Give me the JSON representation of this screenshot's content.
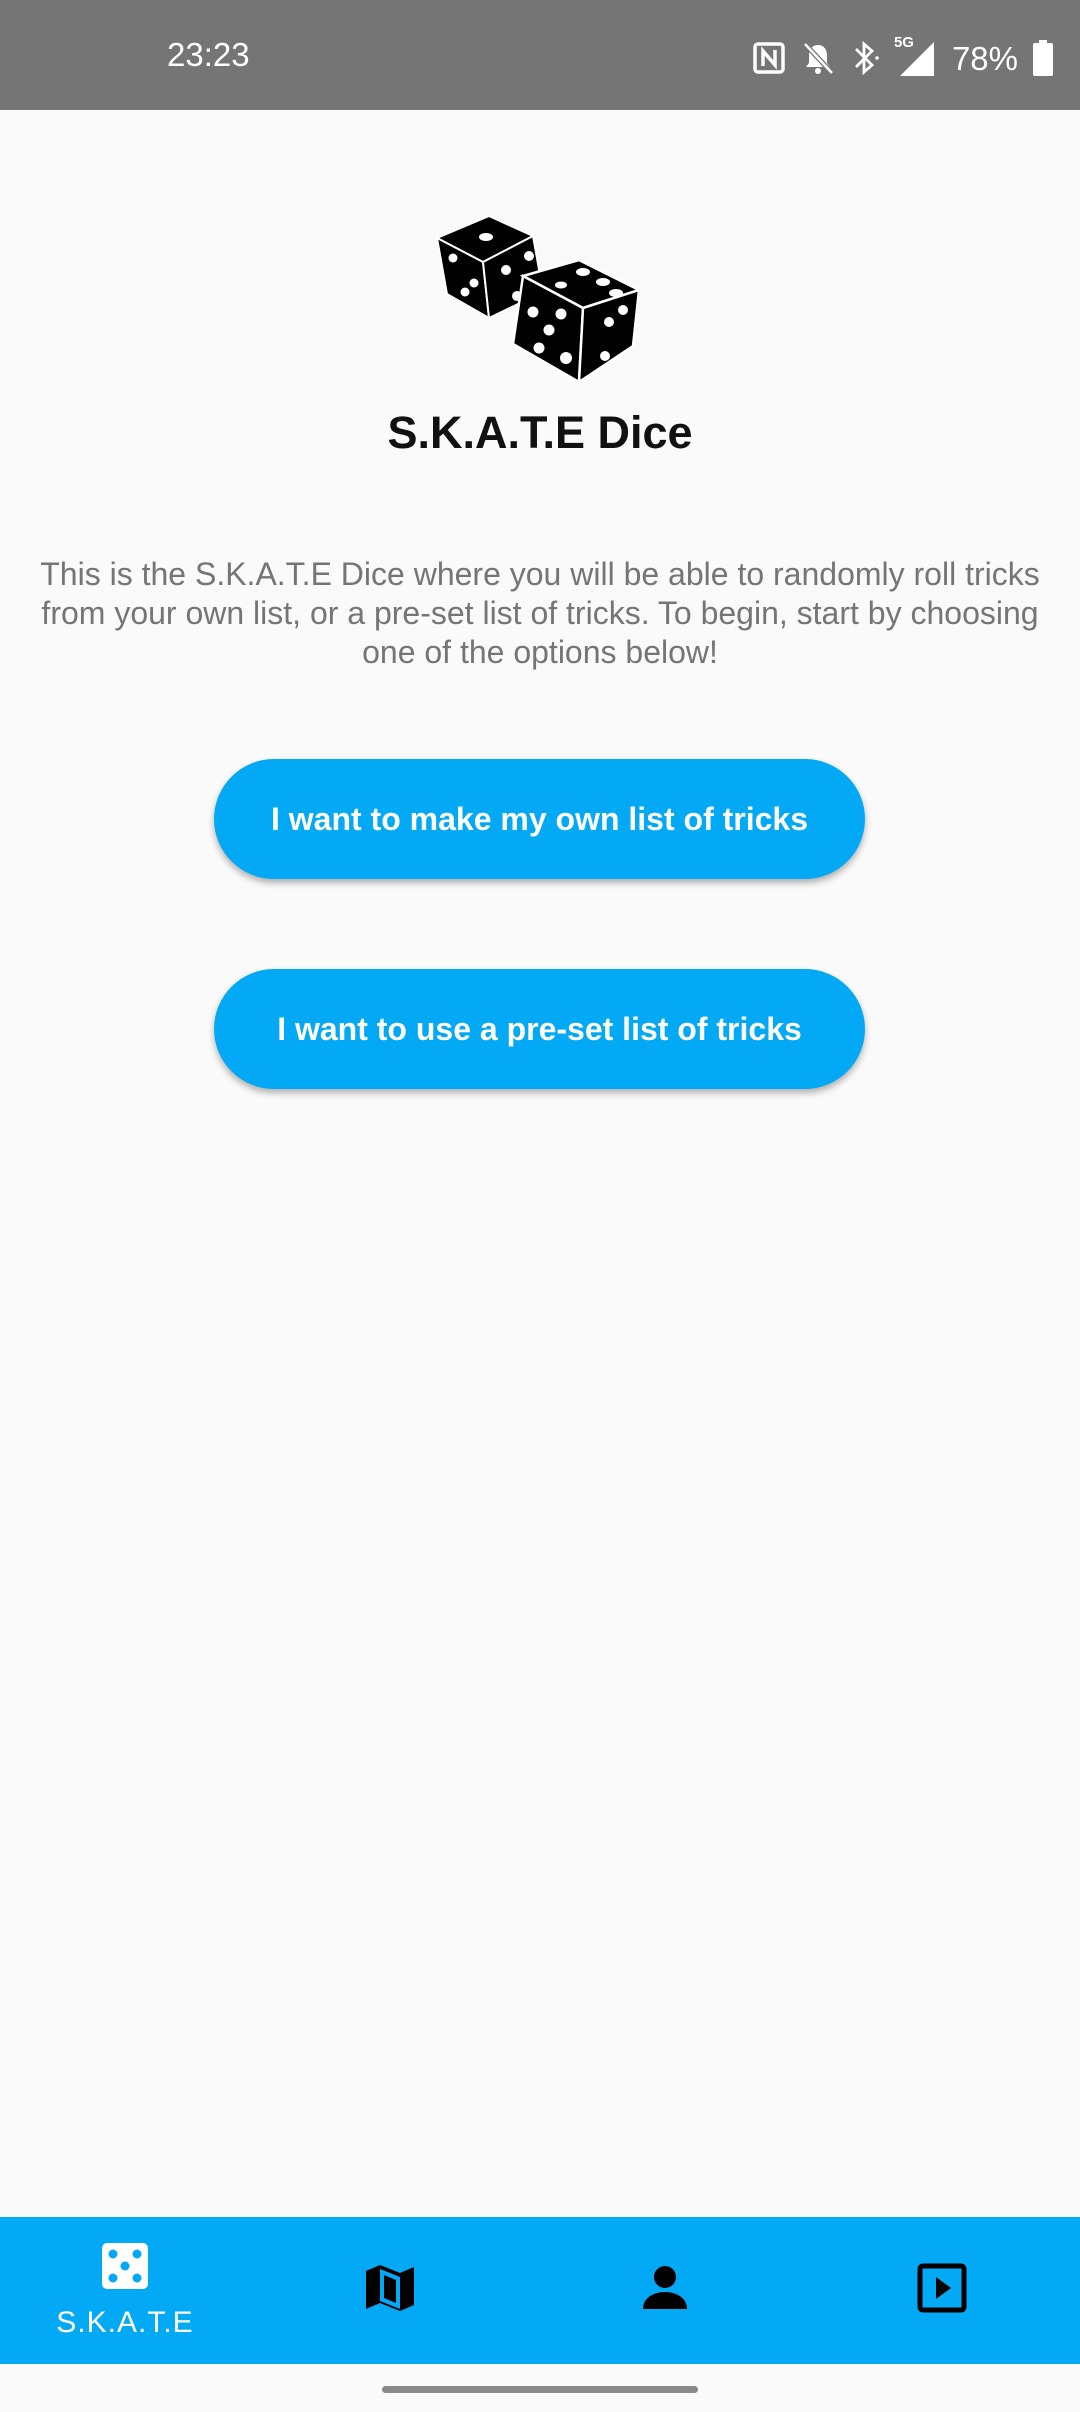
{
  "status_bar": {
    "time": "23:23",
    "battery": "78%",
    "network": "5G",
    "icons": [
      "nfc-icon",
      "bell-off-icon",
      "bluetooth-icon",
      "signal-icon",
      "battery-icon"
    ]
  },
  "header": {
    "logo_icon": "dice-icon",
    "title": "S.K.A.T.E Dice"
  },
  "intro": {
    "text": "This is the S.K.A.T.E Dice where you will be able to randomly roll tricks from your own list, or a pre-set list of tricks. To begin, start by choosing one of the options below!"
  },
  "actions": {
    "own_list_label": "I want to make my own list of tricks",
    "preset_list_label": "I want to use a pre-set list of tricks"
  },
  "bottom_nav": {
    "items": [
      {
        "label": "S.K.A.T.E",
        "icon": "dice-five-icon",
        "selected": true
      },
      {
        "label": "",
        "icon": "map-icon",
        "selected": false
      },
      {
        "label": "",
        "icon": "person-icon",
        "selected": false
      },
      {
        "label": "",
        "icon": "play-box-icon",
        "selected": false
      }
    ]
  },
  "colors": {
    "accent": "#03a9f4",
    "status_bar": "#757575",
    "background": "#fafafa",
    "body_text": "#757575"
  }
}
